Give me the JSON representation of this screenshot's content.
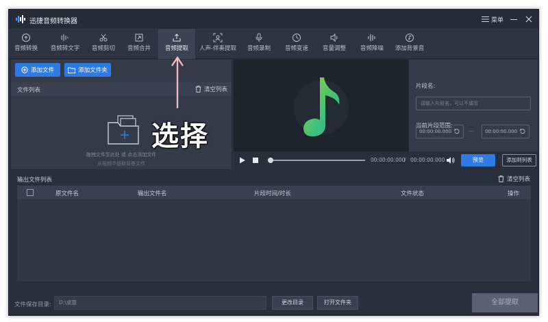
{
  "app": {
    "title": "迅捷音频转换器",
    "menu_label": "菜单"
  },
  "toolbar": {
    "items": [
      {
        "label": "音频转换",
        "icon": "convert-icon"
      },
      {
        "label": "音频转文字",
        "icon": "speech-to-text-icon"
      },
      {
        "label": "音频剪切",
        "icon": "scissors-icon"
      },
      {
        "label": "音频合并",
        "icon": "merge-icon"
      },
      {
        "label": "音频提取",
        "icon": "extract-icon",
        "active": true
      },
      {
        "label": "人声-伴奏提取",
        "icon": "vocal-separate-icon"
      },
      {
        "label": "音频录制",
        "icon": "microphone-icon"
      },
      {
        "label": "音频变速",
        "icon": "speed-icon"
      },
      {
        "label": "音量调整",
        "icon": "volume-icon"
      },
      {
        "label": "音频降噪",
        "icon": "denoise-icon"
      },
      {
        "label": "添加背景音",
        "icon": "music-add-icon"
      }
    ]
  },
  "left": {
    "add_file": "添加文件",
    "add_folder": "添加文件夹",
    "file_list": "文件列表",
    "clear_list": "清空列表",
    "drop_hint": "拖拽文件至此处 或 点击添加文件",
    "drop_hint2": "从视频中提取背景文件",
    "overlay": "选择"
  },
  "player": {
    "current_time": "00:00:00.000",
    "separator": "/",
    "total_time": "00:00:00.000",
    "preview": "预览",
    "add_to_list": "添加到列表"
  },
  "right": {
    "segment_name_label": "片段名:",
    "segment_name_placeholder": "请输入片段名，可以不填写",
    "range_label": "当前片段范围:",
    "start": "00:00:00.000",
    "dash": "—",
    "end": "00:00:00.000"
  },
  "output": {
    "title": "输出文件列表",
    "clear": "清空列表",
    "columns": [
      "原文件名",
      "输出文件名",
      "片段时间/时长",
      "文件状态",
      "操作"
    ]
  },
  "bottom": {
    "save_label": "文件保存目录:",
    "save_path": "D:\\桌面",
    "change_dir": "更改目录",
    "open_folder": "打开文件夹",
    "extract_all": "全部提取"
  },
  "colors": {
    "accent": "#2f7ae5",
    "note_green": "#3fc27a",
    "note_teal": "#2aa5a8"
  }
}
